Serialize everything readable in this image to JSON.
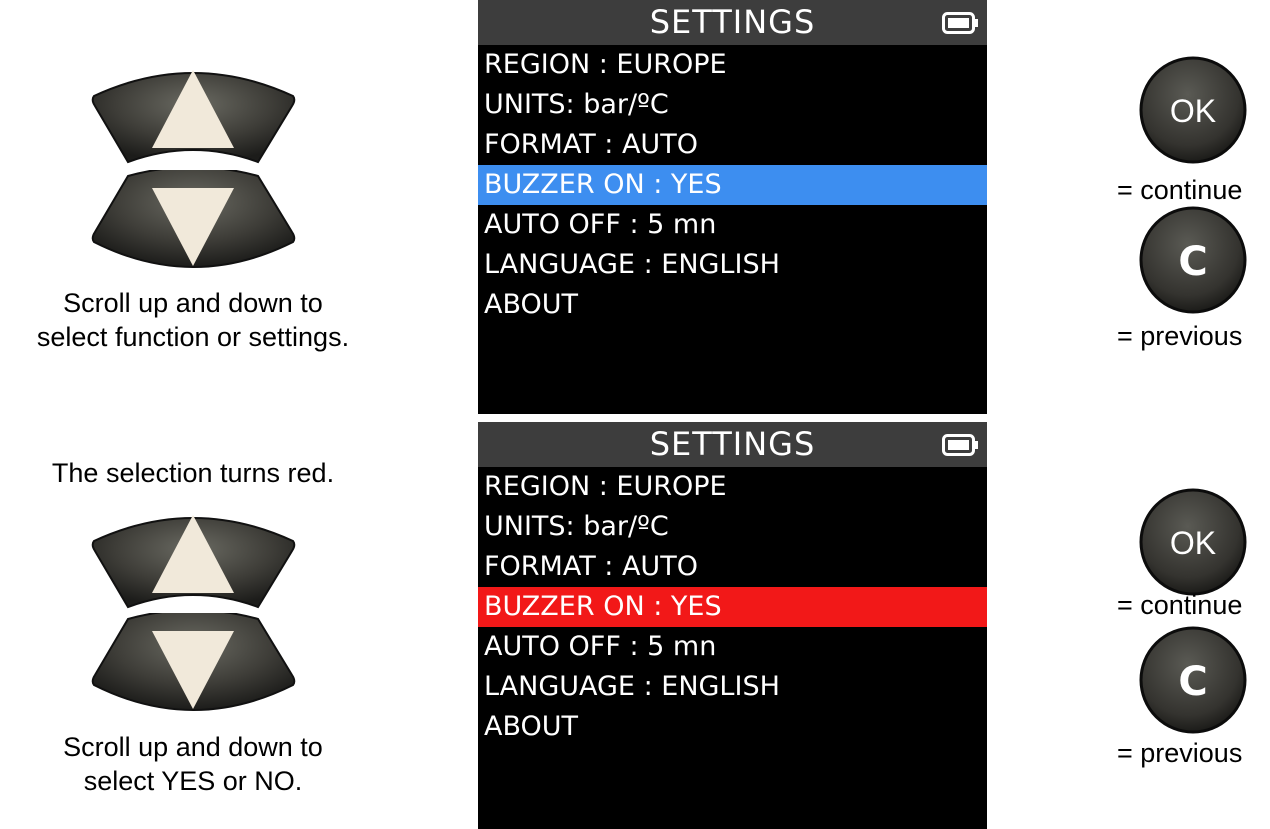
{
  "instructions": {
    "step1_caption_line1": "Scroll up and down to",
    "step1_caption_line2": "select function or settings.",
    "step2_intro": "The selection turns red.",
    "step2_caption_line1": "Scroll up and down to",
    "step2_caption_line2": "select YES or NO."
  },
  "screen_top": {
    "title": "SETTINGS",
    "selected_index": 3,
    "selection_color": "#3d8ef0",
    "items": [
      "REGION : EUROPE",
      "UNITS: bar/ºC",
      "FORMAT : AUTO",
      "BUZZER ON : YES",
      "AUTO OFF : 5 mn",
      "LANGUAGE : ENGLISH",
      "ABOUT"
    ]
  },
  "screen_bottom": {
    "title": "SETTINGS",
    "selected_index": 3,
    "selection_color": "#f21818",
    "items": [
      "REGION : EUROPE",
      "UNITS: bar/ºC",
      "FORMAT : AUTO",
      "BUZZER ON : YES",
      "AUTO OFF : 5 mn",
      "LANGUAGE : ENGLISH",
      "ABOUT"
    ]
  },
  "keys": {
    "ok_label": "OK",
    "c_label": "C",
    "continue_text": "= continue",
    "previous_text": "= previous"
  },
  "icons": {
    "battery": "battery-full-icon",
    "up": "up-arrow-key-icon",
    "down": "down-arrow-key-icon"
  }
}
